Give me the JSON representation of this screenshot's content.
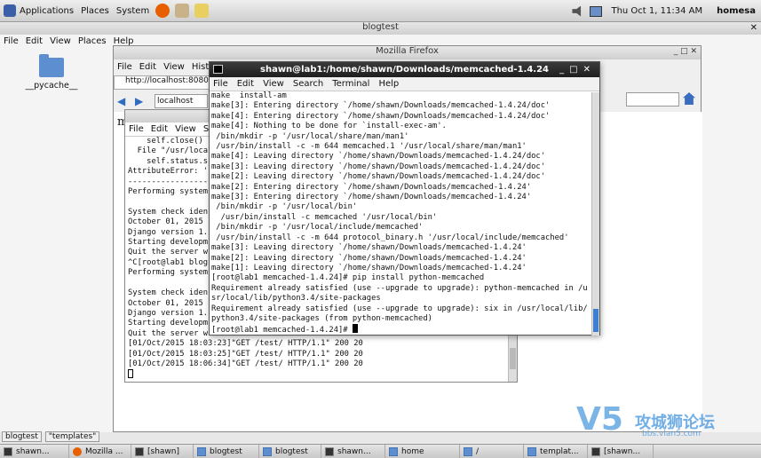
{
  "top_panel": {
    "menus": [
      "Applications",
      "Places",
      "System"
    ],
    "clock": "Thu Oct  1, 11:34 AM",
    "user": "homesa"
  },
  "nautilus": {
    "title": "blogtest",
    "menus": [
      "File",
      "Edit",
      "View",
      "Places",
      "Help"
    ],
    "folder_label": "__pycache__",
    "location_items": [
      "blogtest",
      "\"templates\""
    ]
  },
  "firefox": {
    "title": "Mozilla Firefox",
    "menus": [
      "File",
      "Edit",
      "View",
      "Histo"
    ],
    "tab_label": "http://localhost:8080/",
    "url": "localhost",
    "content_text": "m"
  },
  "back_terminal": {
    "menus": [
      "File",
      "Edit",
      "View",
      "S"
    ],
    "lines": [
      "    self.close()",
      "  File \"/usr/loca",
      "    self.status.s",
      "AttributeError: '",
      "-----------------",
      "Performing system",
      "",
      "System check iden",
      "October 01, 2015",
      "Django version 1.",
      "Starting developm",
      "Quit the server w",
      "^C[root@lab1 blog",
      "Performing system",
      "",
      "System check iden",
      "October 01, 2015",
      "Django version 1.",
      "Starting developm",
      "Quit the server w",
      "[01/Oct/2015 18:03:23]\"GET /test/ HTTP/1.1\" 200 20",
      "[01/Oct/2015 18:03:25]\"GET /test/ HTTP/1.1\" 200 20",
      "[01/Oct/2015 18:06:34]\"GET /test/ HTTP/1.1\" 200 20"
    ]
  },
  "front_terminal": {
    "title": "shawn@lab1:/home/shawn/Downloads/memcached-1.4.24",
    "menus": [
      "File",
      "Edit",
      "View",
      "Search",
      "Terminal",
      "Help"
    ],
    "lines": [
      "make  install-am",
      "make[3]: Entering directory `/home/shawn/Downloads/memcached-1.4.24/doc'",
      "make[4]: Entering directory `/home/shawn/Downloads/memcached-1.4.24/doc'",
      "make[4]: Nothing to be done for `install-exec-am'.",
      " /bin/mkdir -p '/usr/local/share/man/man1'",
      " /usr/bin/install -c -m 644 memcached.1 '/usr/local/share/man/man1'",
      "make[4]: Leaving directory `/home/shawn/Downloads/memcached-1.4.24/doc'",
      "make[3]: Leaving directory `/home/shawn/Downloads/memcached-1.4.24/doc'",
      "make[2]: Leaving directory `/home/shawn/Downloads/memcached-1.4.24/doc'",
      "make[2]: Entering directory `/home/shawn/Downloads/memcached-1.4.24'",
      "make[3]: Entering directory `/home/shawn/Downloads/memcached-1.4.24'",
      " /bin/mkdir -p '/usr/local/bin'",
      "  /usr/bin/install -c memcached '/usr/local/bin'",
      " /bin/mkdir -p '/usr/local/include/memcached'",
      " /usr/bin/install -c -m 644 protocol_binary.h '/usr/local/include/memcached'",
      "make[3]: Leaving directory `/home/shawn/Downloads/memcached-1.4.24'",
      "make[2]: Leaving directory `/home/shawn/Downloads/memcached-1.4.24'",
      "make[1]: Leaving directory `/home/shawn/Downloads/memcached-1.4.24'",
      "[root@lab1 memcached-1.4.24]# pip install python-memcached",
      "Requirement already satisfied (use --upgrade to upgrade): python-memcached in /u",
      "sr/local/lib/python3.4/site-packages",
      "Requirement already satisfied (use --upgrade to upgrade): six in /usr/local/lib/",
      "python3.4/site-packages (from python-memcached)",
      "[root@lab1 memcached-1.4.24]# "
    ]
  },
  "taskbar": {
    "items": [
      "shawn...",
      "Mozilla ...",
      "[shawn]",
      "blogtest",
      "blogtest",
      "shawn...",
      "home",
      "/",
      "templat...",
      "[shawn..."
    ]
  },
  "watermark": {
    "logo": "V5",
    "text": "攻城狮论坛",
    "url": "bbs.vlan5.com"
  }
}
